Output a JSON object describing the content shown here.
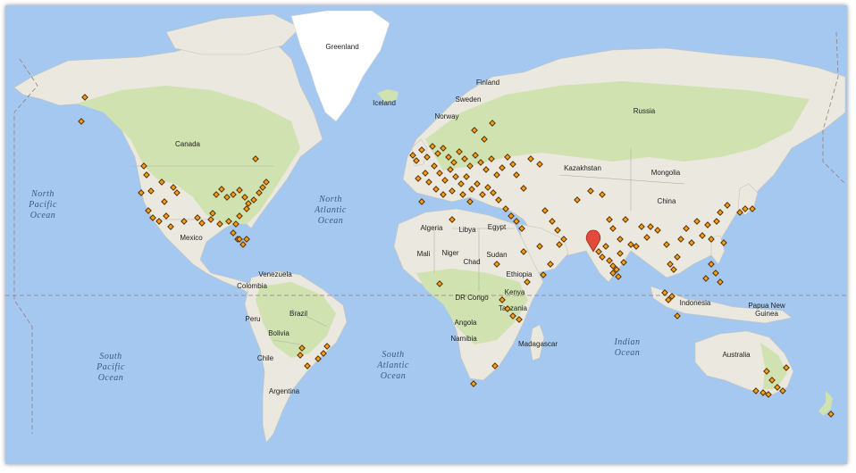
{
  "map": {
    "country_labels": [
      {
        "text": "Greenland"
      },
      {
        "text": "Iceland"
      },
      {
        "text": "Finland"
      },
      {
        "text": "Sweden"
      },
      {
        "text": "Norway"
      },
      {
        "text": "Russia"
      },
      {
        "text": "Canada"
      },
      {
        "text": "Kazakhstan"
      },
      {
        "text": "Mongolia"
      },
      {
        "text": "China"
      },
      {
        "text": "Mexico"
      },
      {
        "text": "Algeria"
      },
      {
        "text": "Libya"
      },
      {
        "text": "Egypt"
      },
      {
        "text": "Mali"
      },
      {
        "text": "Niger"
      },
      {
        "text": "Chad"
      },
      {
        "text": "Sudan"
      },
      {
        "text": "Ethiopia"
      },
      {
        "text": "Kenya"
      },
      {
        "text": "DR Congo"
      },
      {
        "text": "Tanzania"
      },
      {
        "text": "Angola"
      },
      {
        "text": "Namibia"
      },
      {
        "text": "Madagascar"
      },
      {
        "text": "Venezuela"
      },
      {
        "text": "Colombia"
      },
      {
        "text": "Peru"
      },
      {
        "text": "Brazil"
      },
      {
        "text": "Bolivia"
      },
      {
        "text": "Chile"
      },
      {
        "text": "Argentina"
      },
      {
        "text": "Indonesia"
      },
      {
        "text": "Papua New"
      },
      {
        "text": "Guinea"
      },
      {
        "text": "Australia"
      }
    ],
    "ocean_labels": [
      {
        "lines": [
          "North",
          "Pacific",
          "Ocean"
        ]
      },
      {
        "lines": [
          "North",
          "Atlantic",
          "Ocean"
        ]
      },
      {
        "lines": [
          "South",
          "Pacific",
          "Ocean"
        ]
      },
      {
        "lines": [
          "South",
          "Atlantic",
          "Ocean"
        ]
      },
      {
        "lines": [
          "Indian",
          "Ocean"
        ]
      }
    ],
    "colors": {
      "water": "#a4c8f0",
      "land": "#eae8df",
      "vegetation": "#cfe2b0",
      "marker_fill": "#f39c12",
      "marker_stroke": "#4a2a00",
      "pin": "#e24b3b"
    }
  }
}
